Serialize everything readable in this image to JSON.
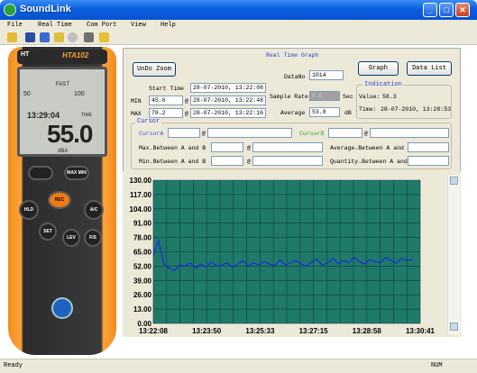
{
  "window": {
    "title": "SoundLink"
  },
  "menu": [
    "File",
    "Real Time",
    "Com Port",
    "View",
    "Help"
  ],
  "device": {
    "brand": "HT",
    "model": "HTA102",
    "mode": "FAST",
    "scale_low": "50",
    "scale_high": "100",
    "time": "13:29:04",
    "time_tag": "TIME",
    "reading": "55.0",
    "unit": "dBA",
    "buttons": [
      "MAX MIN",
      "HLD",
      "REC",
      "A/C",
      "SET",
      "LEV",
      "F/S"
    ]
  },
  "graph": {
    "section_title": "Real Time Graph",
    "undo_zoom": "UnDo Zoom",
    "graph_btn": "Graph",
    "datalist_btn": "Data List",
    "start_time_label": "Start Time",
    "start_time": "28-07-2010, 13:22:08",
    "min_label": "MIN",
    "min_value": "45.6",
    "min_at": "@",
    "min_time": "28-07-2010, 13:22:48",
    "max_label": "MAX",
    "max_value": "78.2",
    "max_at": "@",
    "max_time": "28-07-2010, 13:22:16",
    "datano_label": "DataNo",
    "datano": "1014",
    "sample_rate_label": "Sample Rate",
    "sample_rate": "0.5",
    "sample_unit": "Sec",
    "average_label": "Average",
    "average": "53.8",
    "average_unit": "dB"
  },
  "indication": {
    "title": "Indication",
    "value_label": "Value:",
    "value": "58.3",
    "time_label": "Time:",
    "time": "28-07-2010, 13:28:53"
  },
  "cursor": {
    "title": "Cursor",
    "cursorA": "CursorA",
    "atA": "@",
    "cursorB": "CursorB",
    "atB": "@",
    "max_between": "Max.Between A and B",
    "max_at": "@",
    "min_between": "Min.Between A and B",
    "min_at": "@",
    "avg_between": "Average.Between A and B",
    "qty_between": "Quantity.Between A and B"
  },
  "colors": {
    "chart_bg": "#1f7a6a",
    "trace": "#1a1aff",
    "grid": "#123d36",
    "cursorA": "#4b4bd8",
    "cursorB": "#22aa22"
  },
  "chart_data": {
    "type": "line",
    "y_ticks": [
      "130.00",
      "117.00",
      "104.00",
      "91.00",
      "78.00",
      "65.00",
      "52.00",
      "39.00",
      "26.00",
      "13.00",
      "0.00"
    ],
    "x_ticks": [
      "13:22:08",
      "13:23:50",
      "13:25:33",
      "13:27:15",
      "13:28:58",
      "13:30:41"
    ],
    "ylim": [
      0,
      130
    ],
    "x_range": [
      "13:22:08",
      "13:30:41"
    ],
    "grid": true,
    "series": [
      {
        "values": [
          62,
          75,
          54,
          50,
          48,
          53,
          52,
          55,
          50,
          54,
          51,
          56,
          52,
          53,
          55,
          51,
          54,
          57,
          52,
          55,
          53,
          56,
          54,
          52,
          58,
          53,
          55,
          57,
          54,
          52,
          56,
          58,
          53,
          55,
          59,
          54,
          57,
          55,
          60,
          56,
          54,
          58,
          56,
          55,
          60,
          57,
          55,
          59,
          57,
          58
        ]
      }
    ]
  },
  "status": {
    "text": "Ready",
    "right": "NUM"
  }
}
